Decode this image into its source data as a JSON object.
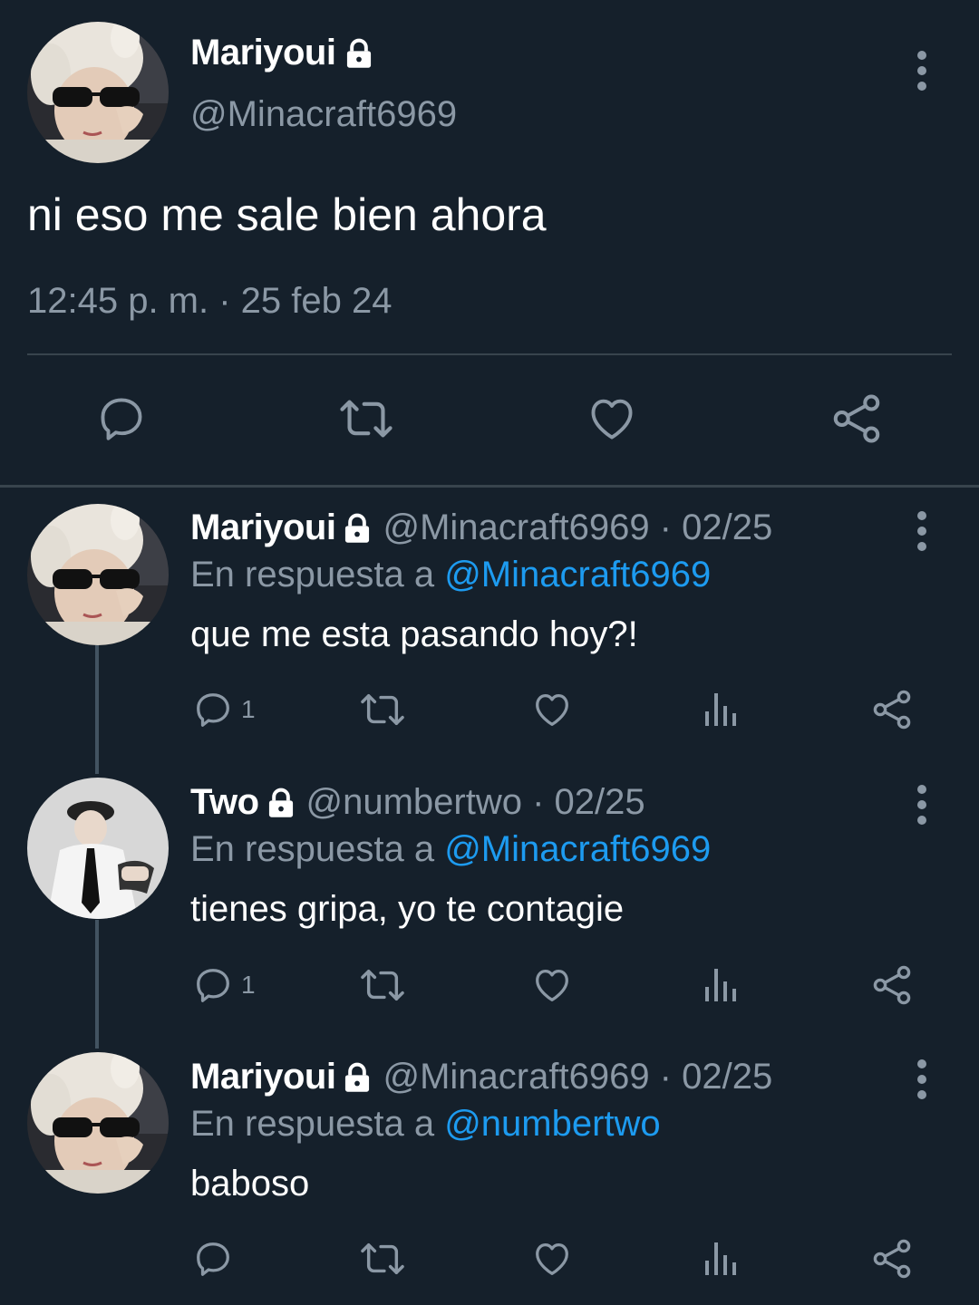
{
  "main_tweet": {
    "name": "Mariyoui",
    "handle": "@Minacraft6969",
    "text": "ni eso me sale bien ahora",
    "timestamp": "12:45 p. m. · 25 feb 24",
    "protected": true,
    "actions": [
      "reply-icon",
      "retweet-icon",
      "like-icon",
      "share-icon"
    ]
  },
  "replies": [
    {
      "name": "Mariyoui",
      "meta": "@Minacraft6969 · 02/25",
      "reply_prefix": "En respuesta a ",
      "reply_to": "@Minacraft6969",
      "text": "que me esta pasando hoy?!",
      "reply_count": "1",
      "avatar": "bunny-hat-avatar"
    },
    {
      "name": "Two",
      "meta": "@numbertwo · 02/25",
      "reply_prefix": "En respuesta a ",
      "reply_to": "@Minacraft6969",
      "text": "tienes gripa, yo te contagie",
      "reply_count": "1",
      "avatar": "cap-avatar"
    },
    {
      "name": "Mariyoui",
      "meta": "@Minacraft6969 · 02/25",
      "reply_prefix": "En respuesta a ",
      "reply_to": "@numbertwo",
      "text": "baboso",
      "reply_count": "",
      "avatar": "bunny-hat-avatar"
    }
  ],
  "colors": {
    "background": "#15202b",
    "secondary_text": "#8b98a5",
    "link": "#1d9bf0",
    "divider": "#38444d"
  }
}
